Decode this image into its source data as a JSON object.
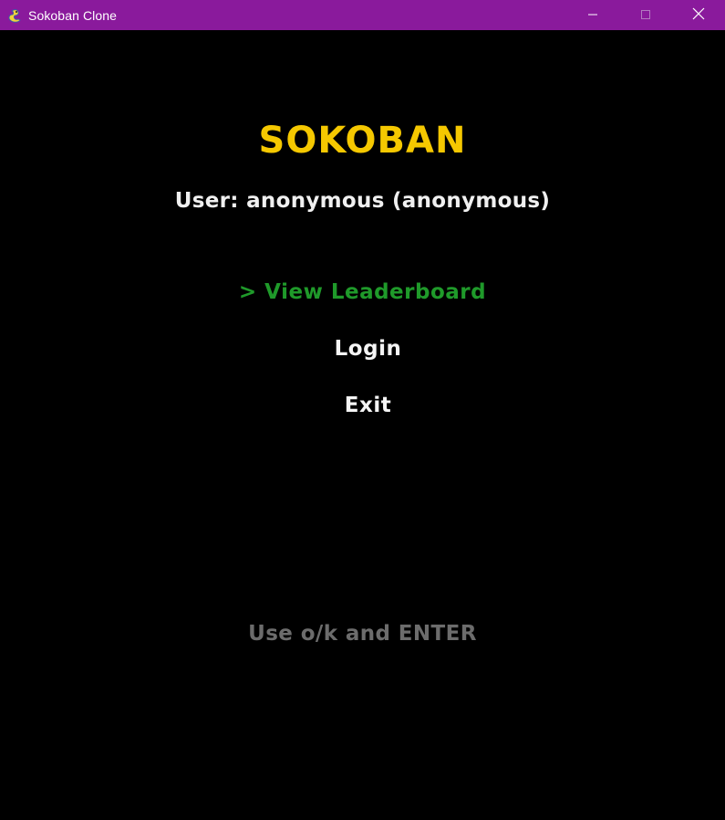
{
  "window": {
    "title": "Sokoban Clone",
    "icon": "pygame-snake-icon",
    "controls": {
      "minimize_icon": "minimize-icon",
      "maximize_icon": "maximize-icon",
      "close_icon": "close-icon"
    },
    "titlebar_color": "#8a1a9c"
  },
  "menu_screen": {
    "title": "SOKOBAN",
    "title_color": "#f5c800",
    "user_line": "User: anonymous (anonymous)",
    "items": [
      {
        "label": "> View Leaderboard",
        "selected": true,
        "color": "#1f9a2a"
      },
      {
        "label": "Login",
        "selected": false,
        "color": "#f5f5f5"
      },
      {
        "label": "Exit",
        "selected": false,
        "color": "#f5f5f5"
      }
    ],
    "hint": "Use o/k and ENTER",
    "hint_color": "#6c6c6c",
    "background": "#000000"
  }
}
